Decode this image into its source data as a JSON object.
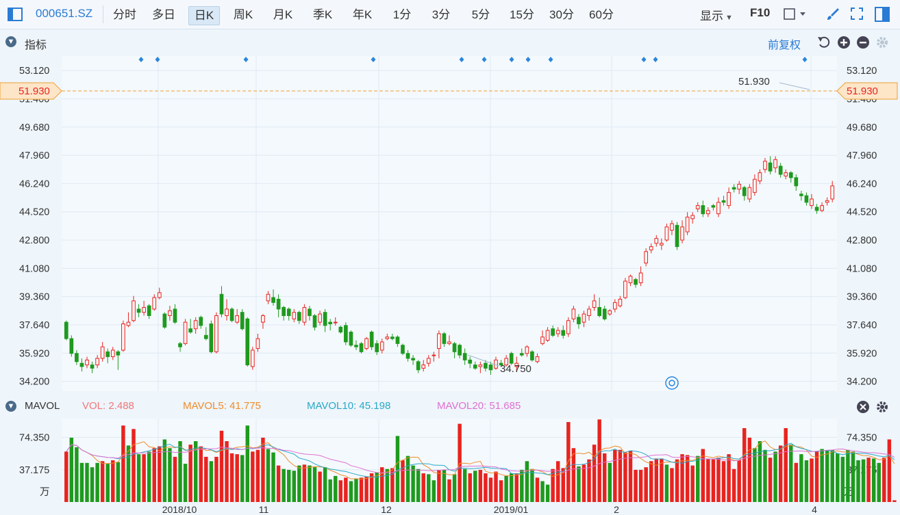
{
  "toolbar": {
    "code": "000651.SZ",
    "tabs": [
      "分时",
      "多日",
      "日K",
      "周K",
      "月K",
      "季K",
      "年K",
      "1分",
      "3分",
      "5分",
      "15分",
      "30分",
      "60分"
    ],
    "active_tab": "日K",
    "display_label": "显示",
    "f10_label": "F10"
  },
  "indicator_header": {
    "label": "指标",
    "fuquan_label": "前复权"
  },
  "price_panel": {
    "y_ticks": [
      "53.120",
      "51.400",
      "49.680",
      "47.960",
      "46.240",
      "44.520",
      "42.800",
      "41.080",
      "39.360",
      "37.640",
      "35.920",
      "34.200"
    ],
    "current_price": "51.930",
    "high_callout": "51.930",
    "low_callout": "34.750",
    "colors": {
      "up": "#e8231f",
      "down": "#1e9a1e",
      "dash": "#f0a030",
      "marker": "#2a86dc"
    }
  },
  "volume_panel": {
    "title": "MAVOL",
    "legend": [
      {
        "label": "VOL: 2.488",
        "color": "#f07878"
      },
      {
        "label": "MAVOL5: 41.775",
        "color": "#f08c28"
      },
      {
        "label": "MAVOL10: 45.198",
        "color": "#28a8c8"
      },
      {
        "label": "MAVOL20: 51.685",
        "color": "#e070d0"
      }
    ],
    "y_ticks": [
      "74.350",
      "37.175"
    ],
    "unit": "万"
  },
  "x_labels": [
    "2018/10",
    "11",
    "12",
    "2019/01",
    "2",
    "4"
  ],
  "chart_data": {
    "type": "candlestick",
    "ylim": [
      33.6,
      54.0
    ],
    "volume_ylim": [
      0,
      96
    ],
    "candles": [
      [
        37.8,
        36.8,
        37.9,
        36.7
      ],
      [
        36.8,
        35.9,
        37.0,
        35.7
      ],
      [
        35.9,
        35.4,
        36.1,
        35.2
      ],
      [
        35.3,
        35.1,
        35.6,
        34.8
      ],
      [
        35.2,
        35.5,
        35.7,
        35.0
      ],
      [
        35.2,
        35.0,
        35.4,
        34.7
      ],
      [
        35.2,
        35.6,
        35.8,
        35.0
      ],
      [
        35.6,
        36.3,
        36.6,
        35.4
      ],
      [
        36.0,
        35.7,
        36.2,
        35.3
      ],
      [
        35.7,
        36.1,
        36.3,
        35.5
      ],
      [
        36.0,
        35.8,
        36.1,
        34.9
      ],
      [
        36.1,
        37.7,
        37.9,
        36.0
      ],
      [
        37.6,
        37.8,
        38.4,
        37.5
      ],
      [
        37.9,
        39.1,
        39.4,
        37.8
      ],
      [
        38.6,
        38.4,
        38.9,
        38.1
      ],
      [
        38.4,
        38.7,
        39.1,
        38.2
      ],
      [
        38.8,
        38.2,
        38.9,
        38.0
      ],
      [
        38.6,
        39.3,
        39.5,
        38.5
      ],
      [
        39.3,
        39.6,
        39.9,
        39.2
      ],
      [
        38.3,
        37.5,
        38.4,
        37.4
      ],
      [
        38.2,
        38.5,
        38.8,
        37.9
      ],
      [
        38.6,
        37.8,
        38.9,
        37.7
      ],
      [
        36.5,
        36.3,
        36.6,
        36.0
      ],
      [
        36.5,
        37.8,
        38.0,
        36.4
      ],
      [
        37.4,
        37.2,
        38.0,
        37.1
      ],
      [
        37.4,
        37.9,
        38.1,
        37.1
      ],
      [
        38.1,
        37.6,
        38.2,
        37.4
      ],
      [
        37.0,
        36.8,
        37.5,
        36.7
      ],
      [
        37.7,
        36.0,
        37.9,
        35.9
      ],
      [
        36.0,
        38.2,
        38.4,
        35.9
      ],
      [
        39.5,
        38.3,
        40.0,
        38.1
      ],
      [
        38.2,
        38.6,
        39.2,
        37.9
      ],
      [
        38.6,
        37.9,
        38.7,
        37.8
      ],
      [
        37.8,
        38.2,
        38.6,
        37.7
      ],
      [
        38.4,
        37.4,
        38.6,
        37.3
      ],
      [
        38.0,
        35.2,
        38.1,
        35.1
      ],
      [
        35.1,
        36.1,
        36.3,
        34.9
      ],
      [
        36.2,
        36.8,
        37.1,
        36.0
      ],
      [
        37.8,
        38.2,
        38.3,
        37.4
      ],
      [
        39.1,
        39.5,
        39.7,
        38.9
      ],
      [
        39.3,
        39.0,
        39.8,
        38.8
      ],
      [
        39.2,
        38.6,
        39.5,
        38.1
      ],
      [
        38.7,
        38.2,
        38.8,
        37.9
      ],
      [
        38.6,
        38.2,
        38.7,
        37.9
      ],
      [
        38.0,
        38.4,
        38.6,
        37.8
      ],
      [
        38.4,
        37.9,
        38.5,
        37.7
      ],
      [
        37.8,
        38.7,
        38.9,
        37.6
      ],
      [
        38.6,
        38.2,
        38.8,
        37.9
      ],
      [
        38.2,
        37.5,
        38.3,
        37.3
      ],
      [
        37.8,
        38.3,
        38.5,
        37.6
      ],
      [
        38.4,
        37.6,
        38.6,
        37.2
      ],
      [
        37.8,
        37.7,
        38.0,
        37.3
      ],
      [
        37.8,
        37.8,
        38.1,
        37.6
      ],
      [
        37.5,
        37.2,
        37.6,
        37.1
      ],
      [
        37.6,
        36.6,
        37.8,
        36.4
      ],
      [
        37.2,
        36.4,
        37.3,
        36.3
      ],
      [
        36.4,
        36.3,
        36.7,
        36.1
      ],
      [
        36.5,
        36.0,
        36.6,
        35.9
      ],
      [
        36.2,
        36.8,
        36.9,
        36.1
      ],
      [
        37.2,
        36.3,
        37.3,
        36.1
      ],
      [
        36.5,
        36.0,
        36.7,
        35.8
      ],
      [
        36.1,
        36.6,
        36.8,
        35.9
      ],
      [
        36.8,
        36.9,
        37.1,
        36.7
      ],
      [
        36.9,
        36.8,
        37.1,
        36.7
      ],
      [
        36.9,
        36.5,
        37.0,
        36.3
      ],
      [
        36.4,
        35.9,
        36.5,
        35.8
      ],
      [
        35.9,
        35.6,
        36.1,
        35.4
      ],
      [
        35.6,
        35.5,
        35.8,
        35.2
      ],
      [
        35.4,
        34.9,
        35.5,
        34.7
      ],
      [
        35.0,
        35.2,
        35.5,
        34.8
      ],
      [
        35.3,
        35.6,
        35.8,
        35.1
      ],
      [
        35.8,
        35.8,
        36.0,
        35.4
      ],
      [
        36.2,
        37.1,
        37.3,
        35.6
      ],
      [
        37.1,
        36.5,
        37.2,
        36.3
      ],
      [
        36.5,
        36.6,
        37.0,
        36.4
      ],
      [
        36.5,
        36.0,
        36.6,
        35.6
      ],
      [
        36.4,
        35.8,
        36.5,
        35.6
      ],
      [
        35.9,
        35.5,
        36.2,
        35.2
      ],
      [
        35.5,
        35.3,
        35.7,
        35.0
      ],
      [
        35.2,
        35.0,
        35.4,
        34.9
      ],
      [
        35.1,
        35.2,
        35.4,
        34.7
      ],
      [
        35.3,
        35.0,
        35.5,
        34.8
      ],
      [
        35.2,
        34.9,
        35.4,
        34.6
      ],
      [
        35.0,
        35.5,
        35.7,
        34.9
      ],
      [
        35.3,
        35.2,
        35.5,
        35.1
      ],
      [
        35.2,
        35.6,
        35.8,
        35.1
      ],
      [
        35.9,
        35.3,
        36.0,
        35.2
      ],
      [
        35.1,
        35.3,
        35.7,
        34.8
      ],
      [
        35.9,
        35.8,
        36.2,
        35.7
      ],
      [
        35.9,
        36.3,
        36.4,
        35.7
      ],
      [
        36.0,
        35.5,
        36.1,
        35.4
      ],
      [
        35.4,
        35.7,
        35.9,
        35.3
      ],
      [
        36.5,
        36.9,
        37.3,
        36.4
      ],
      [
        36.7,
        37.3,
        37.5,
        36.6
      ],
      [
        37.4,
        37.0,
        37.6,
        36.9
      ],
      [
        37.1,
        37.3,
        37.5,
        36.9
      ],
      [
        37.3,
        37.0,
        37.6,
        36.8
      ],
      [
        37.1,
        37.9,
        38.1,
        36.9
      ],
      [
        38.0,
        38.6,
        38.8,
        37.8
      ],
      [
        38.1,
        37.7,
        38.3,
        37.4
      ],
      [
        37.8,
        38.3,
        38.5,
        37.5
      ],
      [
        38.2,
        38.6,
        38.8,
        37.9
      ],
      [
        38.7,
        39.1,
        39.5,
        38.5
      ],
      [
        38.7,
        38.2,
        39.3,
        38.1
      ],
      [
        38.6,
        38.0,
        38.8,
        37.9
      ],
      [
        38.3,
        38.5,
        38.6,
        38.2
      ],
      [
        38.6,
        39.0,
        39.2,
        38.4
      ],
      [
        38.8,
        39.2,
        39.4,
        38.7
      ],
      [
        39.3,
        40.3,
        40.5,
        39.2
      ],
      [
        40.2,
        40.6,
        40.7,
        40.0
      ],
      [
        40.4,
        40.1,
        40.5,
        39.9
      ],
      [
        40.2,
        40.8,
        41.2,
        40.0
      ],
      [
        41.4,
        42.1,
        42.3,
        41.2
      ],
      [
        42.2,
        42.4,
        42.6,
        42.0
      ],
      [
        42.6,
        42.9,
        43.1,
        42.4
      ],
      [
        42.5,
        42.6,
        42.9,
        42.2
      ],
      [
        42.8,
        43.6,
        43.8,
        42.7
      ],
      [
        43.4,
        43.8,
        44.0,
        43.1
      ],
      [
        43.7,
        42.4,
        43.9,
        42.2
      ],
      [
        42.8,
        43.6,
        44.0,
        42.6
      ],
      [
        43.3,
        44.2,
        44.5,
        43.1
      ],
      [
        44.1,
        44.3,
        44.5,
        43.8
      ],
      [
        44.7,
        44.9,
        45.1,
        44.5
      ],
      [
        44.9,
        44.4,
        45.2,
        44.2
      ],
      [
        44.4,
        44.6,
        44.8,
        44.2
      ],
      [
        44.9,
        44.8,
        45.0,
        44.6
      ],
      [
        44.4,
        45.1,
        45.4,
        44.2
      ],
      [
        45.2,
        45.1,
        45.5,
        44.9
      ],
      [
        44.9,
        45.7,
        46.0,
        44.7
      ],
      [
        46.0,
        45.9,
        46.2,
        45.7
      ],
      [
        45.9,
        46.2,
        46.4,
        45.6
      ],
      [
        46.0,
        45.5,
        46.1,
        45.2
      ],
      [
        45.3,
        46.0,
        46.2,
        45.1
      ],
      [
        45.7,
        46.5,
        46.8,
        45.5
      ],
      [
        46.4,
        46.9,
        47.1,
        46.2
      ],
      [
        47.1,
        47.6,
        47.8,
        46.9
      ],
      [
        47.5,
        47.0,
        47.9,
        46.8
      ],
      [
        47.2,
        47.7,
        47.9,
        46.9
      ],
      [
        47.3,
        46.8,
        47.5,
        46.6
      ],
      [
        46.7,
        46.9,
        47.1,
        46.5
      ],
      [
        46.9,
        46.6,
        47.0,
        46.3
      ],
      [
        46.6,
        46.1,
        46.8,
        45.8
      ],
      [
        45.6,
        45.5,
        45.8,
        45.2
      ],
      [
        45.5,
        45.1,
        45.7,
        44.9
      ],
      [
        44.9,
        45.3,
        45.6,
        44.7
      ],
      [
        44.8,
        44.6,
        45.0,
        44.4
      ],
      [
        44.6,
        44.9,
        45.1,
        44.5
      ],
      [
        45.1,
        45.2,
        45.4,
        44.9
      ],
      [
        45.3,
        46.1,
        46.4,
        45.1
      ]
    ],
    "volumes": [
      [
        58,
        1
      ],
      [
        74,
        0
      ],
      [
        63,
        0
      ],
      [
        45,
        0
      ],
      [
        45,
        0
      ],
      [
        40,
        0
      ],
      [
        45,
        0
      ],
      [
        47,
        1
      ],
      [
        44,
        0
      ],
      [
        48,
        1
      ],
      [
        46,
        0
      ],
      [
        88,
        1
      ],
      [
        65,
        0
      ],
      [
        84,
        1
      ],
      [
        55,
        0
      ],
      [
        55,
        1
      ],
      [
        58,
        0
      ],
      [
        62,
        1
      ],
      [
        64,
        1
      ],
      [
        72,
        0
      ],
      [
        62,
        0
      ],
      [
        52,
        1
      ],
      [
        70,
        0
      ],
      [
        44,
        0
      ],
      [
        66,
        1
      ],
      [
        70,
        0
      ],
      [
        64,
        1
      ],
      [
        52,
        1
      ],
      [
        47,
        0
      ],
      [
        52,
        1
      ],
      [
        82,
        1
      ],
      [
        70,
        1
      ],
      [
        56,
        1
      ],
      [
        55,
        1
      ],
      [
        54,
        0
      ],
      [
        88,
        0
      ],
      [
        58,
        1
      ],
      [
        60,
        1
      ],
      [
        74,
        1
      ],
      [
        61,
        0
      ],
      [
        57,
        0
      ],
      [
        42,
        1
      ],
      [
        38,
        0
      ],
      [
        37,
        0
      ],
      [
        36,
        0
      ],
      [
        42,
        0
      ],
      [
        43,
        1
      ],
      [
        42,
        0
      ],
      [
        40,
        0
      ],
      [
        35,
        1
      ],
      [
        40,
        0
      ],
      [
        26,
        0
      ],
      [
        30,
        0
      ],
      [
        25,
        1
      ],
      [
        28,
        1
      ],
      [
        24,
        0
      ],
      [
        27,
        0
      ],
      [
        28,
        1
      ],
      [
        29,
        1
      ],
      [
        33,
        1
      ],
      [
        34,
        0
      ],
      [
        40,
        1
      ],
      [
        38,
        0
      ],
      [
        39,
        1
      ],
      [
        76,
        0
      ],
      [
        48,
        1
      ],
      [
        53,
        0
      ],
      [
        42,
        0
      ],
      [
        38,
        0
      ],
      [
        33,
        1
      ],
      [
        32,
        0
      ],
      [
        25,
        0
      ],
      [
        37,
        1
      ],
      [
        37,
        0
      ],
      [
        26,
        1
      ],
      [
        32,
        0
      ],
      [
        90,
        1
      ],
      [
        38,
        0
      ],
      [
        33,
        1
      ],
      [
        36,
        0
      ],
      [
        37,
        1
      ],
      [
        33,
        1
      ],
      [
        28,
        1
      ],
      [
        35,
        1
      ],
      [
        25,
        1
      ],
      [
        30,
        0
      ],
      [
        33,
        0
      ],
      [
        33,
        1
      ],
      [
        37,
        0
      ],
      [
        47,
        0
      ],
      [
        38,
        0
      ],
      [
        28,
        1
      ],
      [
        24,
        0
      ],
      [
        20,
        0
      ],
      [
        38,
        1
      ],
      [
        47,
        1
      ],
      [
        39,
        1
      ],
      [
        92,
        1
      ],
      [
        62,
        1
      ],
      [
        41,
        0
      ],
      [
        43,
        1
      ],
      [
        49,
        1
      ],
      [
        66,
        1
      ],
      [
        95,
        1
      ],
      [
        56,
        1
      ],
      [
        45,
        0
      ],
      [
        60,
        1
      ],
      [
        60,
        1
      ],
      [
        57,
        1
      ],
      [
        59,
        1
      ],
      [
        37,
        1
      ],
      [
        37,
        1
      ],
      [
        40,
        1
      ],
      [
        47,
        1
      ],
      [
        50,
        1
      ],
      [
        50,
        1
      ],
      [
        43,
        0
      ],
      [
        39,
        1
      ],
      [
        49,
        1
      ],
      [
        55,
        1
      ],
      [
        54,
        1
      ],
      [
        42,
        1
      ],
      [
        53,
        0
      ],
      [
        61,
        1
      ],
      [
        50,
        1
      ],
      [
        49,
        1
      ],
      [
        51,
        1
      ],
      [
        47,
        1
      ],
      [
        55,
        1
      ],
      [
        38,
        1
      ],
      [
        48,
        1
      ],
      [
        85,
        1
      ],
      [
        74,
        1
      ],
      [
        62,
        0
      ],
      [
        70,
        0
      ],
      [
        60,
        0
      ],
      [
        51,
        1
      ],
      [
        58,
        0
      ],
      [
        65,
        1
      ],
      [
        85,
        1
      ],
      [
        66,
        0
      ],
      [
        45,
        1
      ],
      [
        55,
        0
      ],
      [
        48,
        0
      ],
      [
        50,
        1
      ],
      [
        58,
        1
      ],
      [
        61,
        0
      ],
      [
        59,
        0
      ],
      [
        60,
        0
      ],
      [
        56,
        0
      ],
      [
        52,
        0
      ],
      [
        60,
        0
      ],
      [
        58,
        0
      ],
      [
        48,
        0
      ],
      [
        49,
        0
      ],
      [
        51,
        1
      ],
      [
        50,
        0
      ],
      [
        45,
        0
      ],
      [
        51,
        1
      ],
      [
        72,
        1
      ],
      [
        2,
        1
      ]
    ]
  }
}
